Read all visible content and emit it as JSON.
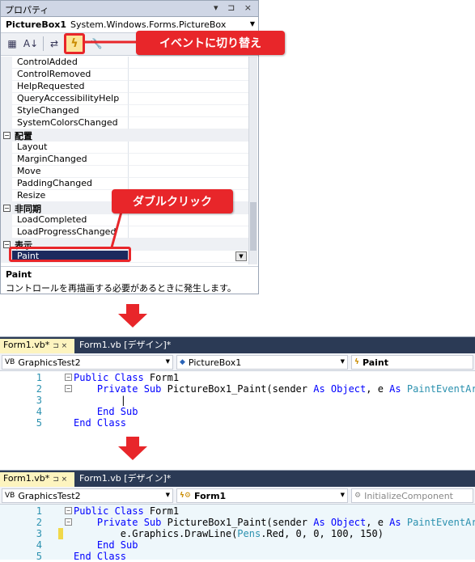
{
  "props": {
    "title": "プロパティ",
    "title_controls": "▾ ⊐ ×",
    "object_name": "PictureBox1",
    "object_type": "System.Windows.Forms.PictureBox",
    "rows": [
      {
        "kind": "prop",
        "name": "ControlAdded"
      },
      {
        "kind": "prop",
        "name": "ControlRemoved"
      },
      {
        "kind": "prop",
        "name": "HelpRequested"
      },
      {
        "kind": "prop",
        "name": "QueryAccessibilityHelp"
      },
      {
        "kind": "prop",
        "name": "StyleChanged"
      },
      {
        "kind": "prop",
        "name": "SystemColorsChanged"
      },
      {
        "kind": "cat",
        "name": "配置"
      },
      {
        "kind": "prop",
        "name": "Layout"
      },
      {
        "kind": "prop",
        "name": "MarginChanged"
      },
      {
        "kind": "prop",
        "name": "Move"
      },
      {
        "kind": "prop",
        "name": "PaddingChanged"
      },
      {
        "kind": "prop",
        "name": "Resize"
      },
      {
        "kind": "cat",
        "name": "非同期"
      },
      {
        "kind": "prop",
        "name": "LoadCompleted"
      },
      {
        "kind": "prop",
        "name": "LoadProgressChanged"
      },
      {
        "kind": "cat",
        "name": "表示"
      },
      {
        "kind": "prop",
        "name": "Paint",
        "selected": true
      }
    ],
    "description_title": "Paint",
    "description_text": "コントロールを再描画する必要があるときに発生します。"
  },
  "callouts": {
    "switch_to_events": "イベントに切り替え",
    "double_click": "ダブルクリック"
  },
  "editor1": {
    "tab_active": "Form1.vb*",
    "tab_inactive": "Form1.vb [デザイン]*",
    "combo_project": "GraphicsTest2",
    "combo_object": "PictureBox1",
    "combo_event": "Paint",
    "lines": [
      {
        "num": "1",
        "html": "<span class='kw'>Public Class</span> Form1"
      },
      {
        "num": "2",
        "html": "    <span class='kw'>Private Sub</span> PictureBox1_Paint(sender <span class='kw'>As Object</span>, e <span class='kw'>As</span> <span class='ty'>PaintEventArgs</span>"
      },
      {
        "num": "3",
        "html": "        |"
      },
      {
        "num": "4",
        "html": "    <span class='kw'>End Sub</span>"
      },
      {
        "num": "5",
        "html": "<span class='kw'>End Class</span>"
      }
    ]
  },
  "editor2": {
    "tab_active": "Form1.vb*",
    "tab_inactive": "Form1.vb [デザイン]*",
    "combo_project": "GraphicsTest2",
    "combo_object": "Form1",
    "combo_event": "InitializeComponent",
    "lines": [
      {
        "num": "1",
        "html": "<span class='kw'>Public Class</span> Form1"
      },
      {
        "num": "2",
        "html": "    <span class='kw'>Private Sub</span> PictureBox1_Paint(sender <span class='kw'>As Object</span>, e <span class='kw'>As</span> <span class='ty'>PaintEventArgs</span>"
      },
      {
        "num": "3",
        "html": "        e.Graphics.DrawLine(<span class='ty'>Pens</span>.Red, 0, 0, 100, 150)"
      },
      {
        "num": "4",
        "html": "    <span class='kw'>End Sub</span>"
      },
      {
        "num": "5",
        "html": "<span class='kw'>End Class</span>"
      }
    ]
  },
  "colors": {
    "callout": "#e8262a",
    "tab_active": "#fdf4bf",
    "tab_bar": "#2b3a55",
    "keyword": "#0000ff",
    "type": "#2b91af"
  }
}
